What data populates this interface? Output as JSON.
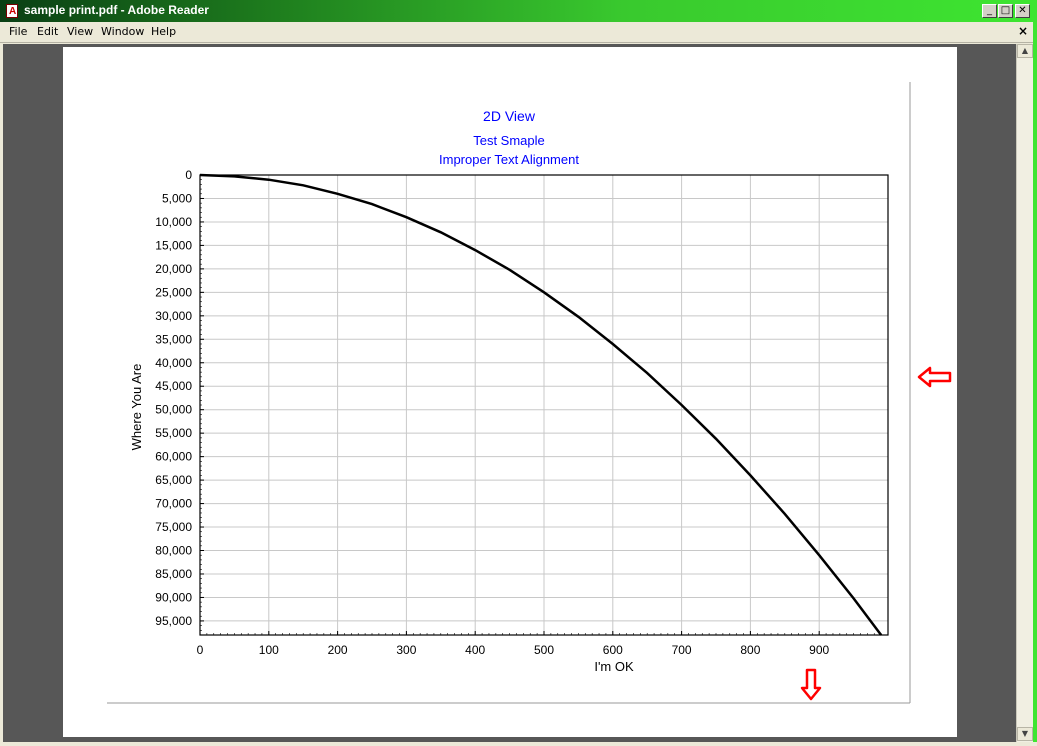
{
  "window": {
    "title": "sample print.pdf - Adobe Reader",
    "minimize_glyph": "_",
    "maximize_glyph": "□",
    "close_glyph": "✕",
    "doc_close_glyph": "×",
    "app_icon_glyph": "A"
  },
  "menu": {
    "items": [
      "File",
      "Edit",
      "View",
      "Window",
      "Help"
    ]
  },
  "scrollbar": {
    "up_glyph": "▲",
    "down_glyph": "▼"
  },
  "chart_data": {
    "type": "line",
    "title": "2D View",
    "subtitle_1": "Test Smaple",
    "subtitle_2": "Improper Text Alignment",
    "xlabel": "I'm OK",
    "ylabel": "Where You Are",
    "xlim": [
      0,
      1000
    ],
    "ylim": [
      0,
      98000
    ],
    "y_inverted": true,
    "grid": true,
    "title_color": "#0000ff",
    "line_color": "#000000",
    "x_ticks": [
      0,
      100,
      200,
      300,
      400,
      500,
      600,
      700,
      800,
      900
    ],
    "x_tick_labels": [
      "0",
      "100",
      "200",
      "300",
      "400",
      "500",
      "600",
      "700",
      "800",
      "900"
    ],
    "y_ticks": [
      0,
      5000,
      10000,
      15000,
      20000,
      25000,
      30000,
      35000,
      40000,
      45000,
      50000,
      55000,
      60000,
      65000,
      70000,
      75000,
      80000,
      85000,
      90000,
      95000
    ],
    "y_tick_labels": [
      "0",
      "5,000",
      "10,000",
      "15,000",
      "20,000",
      "25,000",
      "30,000",
      "35,000",
      "40,000",
      "45,000",
      "50,000",
      "55,000",
      "60,000",
      "65,000",
      "70,000",
      "75,000",
      "80,000",
      "85,000",
      "90,000",
      "95,000"
    ],
    "series": [
      {
        "x": [
          0,
          50,
          100,
          150,
          200,
          250,
          300,
          350,
          400,
          450,
          500,
          550,
          600,
          650,
          700,
          750,
          800,
          850,
          900,
          950,
          990
        ],
        "y": [
          0,
          300,
          1000,
          2200,
          4000,
          6200,
          9000,
          12200,
          16000,
          20200,
          25000,
          30200,
          36000,
          42200,
          49000,
          56200,
          64000,
          72200,
          81000,
          90200,
          98000
        ]
      }
    ]
  },
  "annotations": {
    "arrow_color": "#ff0000",
    "left_arrow_icon": "left-arrow-outline",
    "down_arrow_icon": "down-arrow-outline"
  }
}
